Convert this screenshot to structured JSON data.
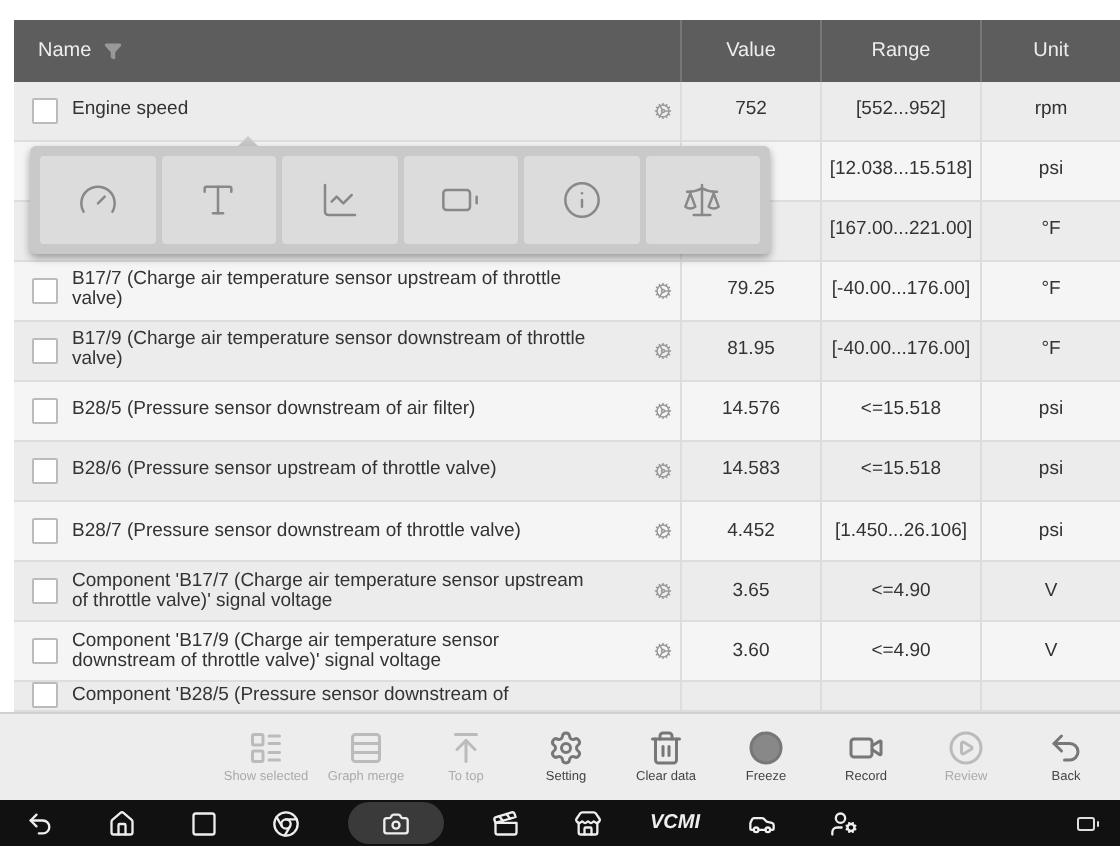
{
  "table": {
    "columns": [
      {
        "label": "Name",
        "kind": "name"
      },
      {
        "label": "Value",
        "kind": "value"
      },
      {
        "label": "Range",
        "kind": "range"
      },
      {
        "label": "Unit",
        "kind": "unit"
      }
    ],
    "rows": [
      {
        "name": "Engine speed",
        "checked": false,
        "value": "752",
        "range": "[552...952]",
        "unit": "rpm"
      },
      {
        "range": "[12.038...15.518]",
        "unit": "psi"
      },
      {
        "range": "[167.00...221.00]",
        "unit": "°F"
      },
      {
        "name": "B17/7 (Charge air temperature sensor upstream of throttle valve)",
        "checked": false,
        "value": "79.25",
        "range": "[-40.00...176.00]",
        "unit": "°F"
      },
      {
        "name": "B17/9 (Charge air temperature sensor downstream of throttle valve)",
        "checked": false,
        "value": "81.95",
        "range": "[-40.00...176.00]",
        "unit": "°F"
      },
      {
        "name": "B28/5 (Pressure sensor downstream of air filter)",
        "checked": false,
        "value": "14.576",
        "range": "<=15.518",
        "unit": "psi"
      },
      {
        "name": "B28/6 (Pressure sensor upstream of throttle valve)",
        "checked": false,
        "value": "14.583",
        "range": "<=15.518",
        "unit": "psi"
      },
      {
        "name": "B28/7 (Pressure sensor downstream of throttle valve)",
        "checked": false,
        "value": "4.452",
        "range": "[1.450...26.106]",
        "unit": "psi"
      },
      {
        "name": "Component 'B17/7 (Charge air temperature sensor upstream of throttle valve)' signal voltage",
        "checked": false,
        "value": "3.65",
        "range": "<=4.90",
        "unit": "V"
      },
      {
        "name": "Component 'B17/9 (Charge air temperature sensor downstream of throttle valve)' signal voltage",
        "checked": false,
        "value": "3.60",
        "range": "<=4.90",
        "unit": "V"
      },
      {
        "name": "Component 'B28/5 (Pressure sensor downstream of",
        "checked": false,
        "partial": true
      }
    ]
  },
  "popup": {
    "items": [
      {
        "kind": "gauge"
      },
      {
        "kind": "text"
      },
      {
        "kind": "graph"
      },
      {
        "kind": "digital"
      },
      {
        "kind": "info"
      },
      {
        "kind": "compare"
      }
    ]
  },
  "toolbar": [
    {
      "kind": "show",
      "label": "Show selected",
      "disabled": true
    },
    {
      "kind": "merge",
      "label": "Graph merge",
      "disabled": true
    },
    {
      "kind": "top",
      "label": "To top",
      "disabled": true
    },
    {
      "kind": "setting",
      "label": "Setting",
      "disabled": false
    },
    {
      "kind": "clear",
      "label": "Clear data",
      "disabled": false
    },
    {
      "kind": "freeze",
      "label": "Freeze",
      "disabled": false
    },
    {
      "kind": "record",
      "label": "Record",
      "disabled": false
    },
    {
      "kind": "review",
      "label": "Review",
      "disabled": true
    },
    {
      "kind": "back",
      "label": "Back",
      "disabled": false
    }
  ],
  "navbar": {
    "items": [
      {
        "kind": "back",
        "selected": false
      },
      {
        "kind": "home",
        "selected": false
      },
      {
        "kind": "recent",
        "selected": false
      },
      {
        "kind": "browser",
        "selected": false
      },
      {
        "kind": "camera",
        "selected": true
      },
      {
        "kind": "video",
        "selected": false
      },
      {
        "kind": "shop",
        "selected": false
      },
      {
        "kind": "vci",
        "label": "VCMI",
        "selected": false
      },
      {
        "kind": "car",
        "selected": false
      },
      {
        "kind": "user",
        "selected": false
      }
    ]
  }
}
